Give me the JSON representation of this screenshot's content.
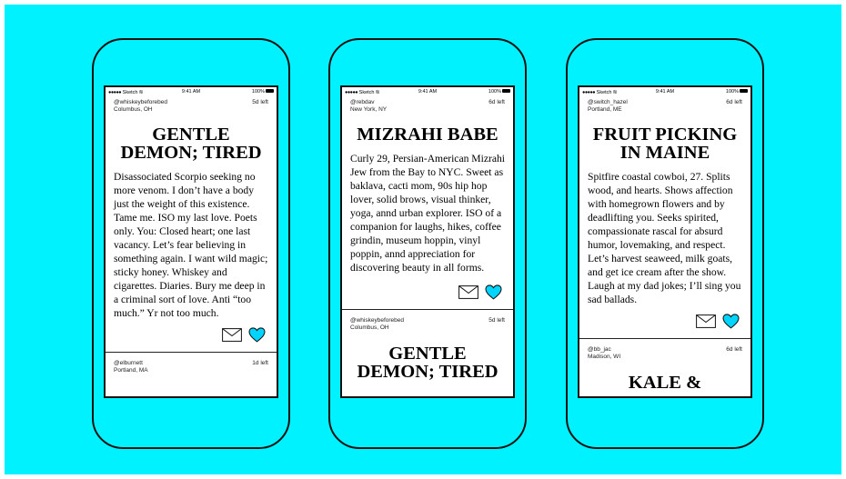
{
  "status_bar": {
    "carrier": "Sketch",
    "time": "9:41 AM",
    "battery": "100%"
  },
  "phones": [
    {
      "card": {
        "handle": "@whiskeybeforebed",
        "location": "Columbus, OH",
        "days_left": "5d left",
        "title_line1": "GENTLE",
        "title_line2": "DEMON; TIRED",
        "bio": "Disassociated Scorpio seeking no more venom. I don’t have a body just the weight of this existence. Tame me. ISO my last love. Poets only. You: Closed heart; one last vacancy. Let’s fear believing in something again. I want wild magic; sticky honey. Whiskey and cigarettes. Diaries. Bury me deep in a criminal sort of love. Anti “too much.” Yr not too much."
      },
      "next": {
        "handle": "@elburnett",
        "location": "Portland, MA",
        "days_left": "1d left"
      }
    },
    {
      "card": {
        "handle": "@rebdav",
        "location": "New York, NY",
        "days_left": "6d left",
        "title_line1": "MIZRAHI BABE",
        "title_line2": "",
        "bio": "Curly 29, Persian-American Mizrahi Jew from the Bay to NYC. Sweet as baklava, cacti mom, 90s hip hop lover, solid brows, visual thinker, yoga, annd urban explorer. ISO of a companion for laughs, hikes, coffee grindin, museum hoppin, vinyl poppin, annd appreciation for discovering beauty in all forms."
      },
      "next": {
        "handle": "@whiskeybeforebed",
        "location": "Columbus, OH",
        "days_left": "5d left",
        "title_line1": "GENTLE",
        "title_line2": "DEMON; TIRED"
      }
    },
    {
      "card": {
        "handle": "@switch_hazel",
        "location": "Portland, ME",
        "days_left": "6d left",
        "title_line1": "FRUIT PICKING",
        "title_line2": "IN MAINE",
        "bio": "Spitfire coastal cowboi, 27. Splits wood, and hearts. Shows affection with homegrown flowers and by deadlifting you. Seeks spirited, compassionate rascal for absurd humor, lovemaking, and respect. Let’s harvest seaweed, milk goats, and get ice cream after the show. Laugh at my dad jokes; I’ll sing you sad ballads."
      },
      "next": {
        "handle": "@bb_jac",
        "location": "Madison, WI",
        "days_left": "6d left",
        "title_line1": "KALE &",
        "title_line2": ""
      }
    }
  ],
  "colors": {
    "background": "#00f1ff",
    "heart": "#00d4ff",
    "outline": "#111111"
  }
}
